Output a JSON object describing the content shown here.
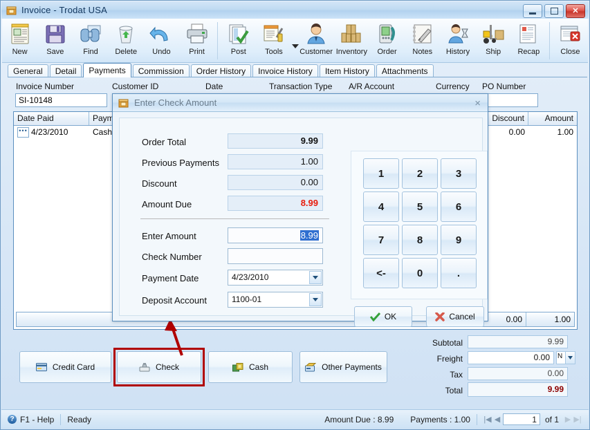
{
  "window": {
    "title": "Invoice - Trodat USA",
    "icon": "invoice-window-icon",
    "minimize_label": "Minimize",
    "maximize_label": "Maximize",
    "close_label": "Close"
  },
  "toolbar": {
    "items": [
      {
        "label": "New",
        "icon": "new-document-icon"
      },
      {
        "label": "Save",
        "icon": "floppy-disk-icon"
      },
      {
        "label": "Find",
        "icon": "binoculars-icon"
      },
      {
        "label": "Delete",
        "icon": "recycle-bin-icon"
      },
      {
        "label": "Undo",
        "icon": "undo-arrow-icon"
      },
      {
        "label": "Print",
        "icon": "printer-icon"
      },
      {
        "label": "Post",
        "icon": "post-checkmark-icon"
      },
      {
        "label": "Tools",
        "icon": "tools-wrench-icon"
      },
      {
        "label": "Customer",
        "icon": "customer-person-icon"
      },
      {
        "label": "Inventory",
        "icon": "inventory-boxes-icon"
      },
      {
        "label": "Order",
        "icon": "order-phone-icon"
      },
      {
        "label": "Notes",
        "icon": "notes-pencil-icon"
      },
      {
        "label": "History",
        "icon": "history-hourglass-icon"
      },
      {
        "label": "Ship",
        "icon": "ship-forklift-icon"
      },
      {
        "label": "Recap",
        "icon": "recap-report-icon"
      },
      {
        "label": "Close",
        "icon": "close-window-icon"
      }
    ]
  },
  "tabs": [
    {
      "label": "General",
      "active": false
    },
    {
      "label": "Detail",
      "active": false
    },
    {
      "label": "Payments",
      "active": true
    },
    {
      "label": "Commission",
      "active": false
    },
    {
      "label": "Order History",
      "active": false
    },
    {
      "label": "Invoice History",
      "active": false
    },
    {
      "label": "Item History",
      "active": false
    },
    {
      "label": "Attachments",
      "active": false
    }
  ],
  "form": {
    "headers": [
      "Invoice Number",
      "Customer ID",
      "Date",
      "Transaction Type",
      "A/R Account",
      "Currency",
      "PO Number"
    ],
    "invoice_number": "SI-10148",
    "po_number": ""
  },
  "grid": {
    "columns": [
      "Date Paid",
      "Payment",
      "Discount",
      "Amount"
    ],
    "rows": [
      {
        "date_paid": "4/23/2010",
        "payment": "Cash",
        "discount": "0.00",
        "amount": "1.00"
      }
    ],
    "footer": {
      "discount": "0.00",
      "amount": "1.00"
    }
  },
  "dialog": {
    "title": "Enter Check Amount",
    "icon": "dialog-invoice-icon",
    "close_label": "×",
    "summary": [
      {
        "label": "Order Total",
        "value": "9.99",
        "style": "bold"
      },
      {
        "label": "Previous Payments",
        "value": "1.00",
        "style": "normal"
      },
      {
        "label": "Discount",
        "value": "0.00",
        "style": "normal"
      },
      {
        "label": "Amount Due",
        "value": "8.99",
        "style": "red"
      }
    ],
    "fields": {
      "enter_amount_label": "Enter Amount",
      "enter_amount_value": "8.99",
      "check_number_label": "Check Number",
      "check_number_value": "",
      "payment_date_label": "Payment Date",
      "payment_date_value": "4/23/2010",
      "deposit_account_label": "Deposit Account",
      "deposit_account_value": "1100-01"
    },
    "keypad": [
      "1",
      "2",
      "3",
      "4",
      "5",
      "6",
      "7",
      "8",
      "9",
      "<-",
      "0",
      "."
    ],
    "ok_label": "OK",
    "cancel_label": "Cancel"
  },
  "payment_buttons": [
    {
      "label": "Credit Card",
      "icon": "credit-card-icon",
      "highlighted": false
    },
    {
      "label": "Check",
      "icon": "check-payment-icon",
      "highlighted": true
    },
    {
      "label": "Cash",
      "icon": "cash-money-icon",
      "highlighted": false
    },
    {
      "label": "Other Payments",
      "icon": "other-payments-icon",
      "highlighted": false
    }
  ],
  "totals": [
    {
      "label": "Subtotal",
      "value": "9.99",
      "style": "readonly"
    },
    {
      "label": "Freight",
      "value": "0.00",
      "style": "editable",
      "combo": "N"
    },
    {
      "label": "Tax",
      "value": "0.00",
      "style": "readonly"
    },
    {
      "label": "Total",
      "value": "9.99",
      "style": "total"
    }
  ],
  "statusbar": {
    "help": "F1 - Help",
    "state": "Ready",
    "amount_due": "Amount Due : 8.99",
    "payments": "Payments : 1.00",
    "page_current": "1",
    "page_of": "of 1"
  },
  "annotation": {
    "arrow_color": "#b00000",
    "highlight_color": "#b00000"
  }
}
